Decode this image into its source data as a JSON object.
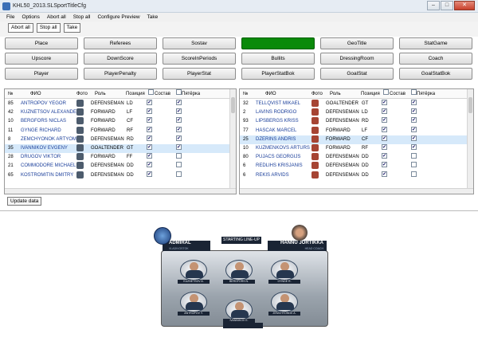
{
  "window": {
    "title": "KHL50_2013.SLSportTitleCfg",
    "buttons": [
      "–",
      "□",
      "✕"
    ]
  },
  "menu": [
    "File",
    "Options",
    "Abort all",
    "Stop all",
    "Configure Preview",
    "Take"
  ],
  "toolbar": [
    "Abort all",
    "Stop all",
    "Take"
  ],
  "grid_buttons": [
    "Place",
    "Referees",
    "Sostav",
    "Starting",
    "GeoTitle",
    "StatGame",
    "Upscore",
    "DownScore",
    "ScoreInPeriods",
    "Bullits",
    "DressingRoom",
    "Coach",
    "Player",
    "PlayerPenalty",
    "PlayerStat",
    "PlayerStatBok",
    "GoalStat",
    "GoalStatBok"
  ],
  "active_button": "Starting",
  "active_color": "#0a8a0a",
  "columns": [
    "№",
    "ФИО",
    "Фото",
    "Роль",
    "Позиция",
    "Состав",
    "Пятёрка"
  ],
  "left_rows": [
    {
      "num": "85",
      "name": "ANTROPOV YEGOR",
      "role": "DEFENSEMAN",
      "pos": "LD",
      "sostav": "✔",
      "pyat": "✔"
    },
    {
      "num": "42",
      "name": "KUZNETSOV ALEXANDER",
      "role": "FORWARD",
      "pos": "LF",
      "sostav": "✔",
      "pyat": "✔"
    },
    {
      "num": "10",
      "name": "BERGFORS NICLAS",
      "role": "FORWARD",
      "pos": "CF",
      "sostav": "✔",
      "pyat": "✔"
    },
    {
      "num": "11",
      "name": "GYNGE RICHARD",
      "role": "FORWARD",
      "pos": "RF",
      "sostav": "✔",
      "pyat": "✔"
    },
    {
      "num": "8",
      "name": "ZEMCHYONOK ARTYOM",
      "role": "DEFENSEMAN",
      "pos": "RD",
      "sostav": "✔",
      "pyat": "✔"
    },
    {
      "num": "35",
      "name": "IVANNIKOV EVGENY",
      "role": "GOALTENDER",
      "pos": "GT",
      "sostav": "✔",
      "pyat": "✔"
    },
    {
      "num": "28",
      "name": "DRUGOV VIKTOR",
      "role": "FORWARD",
      "pos": "FF",
      "sostav": "✔",
      "pyat": ""
    },
    {
      "num": "21",
      "name": "COMMODORE MICHAEL",
      "role": "DEFENSEMAN",
      "pos": "DD",
      "sostav": "✔",
      "pyat": ""
    },
    {
      "num": "65",
      "name": "KOSTROMITIN DMITRY",
      "role": "DEFENSEMAN",
      "pos": "DD",
      "sostav": "✔",
      "pyat": ""
    }
  ],
  "left_selected": 5,
  "right_rows": [
    {
      "num": "32",
      "name": "TELLQVIST MIKAEL",
      "role": "GOALTENDER",
      "pos": "GT",
      "sostav": "✔",
      "pyat": "✔"
    },
    {
      "num": "2",
      "name": "LAVINS RODRIGO",
      "role": "DEFENSEMAN",
      "pos": "LD",
      "sostav": "✔",
      "pyat": "✔"
    },
    {
      "num": "93",
      "name": "LIPSBERGS KRISS",
      "role": "DEFENSEMAN",
      "pos": "RD",
      "sostav": "✔",
      "pyat": "✔"
    },
    {
      "num": "77",
      "name": "HASCAK MARCEL",
      "role": "FORWARD",
      "pos": "LF",
      "sostav": "✔",
      "pyat": "✔"
    },
    {
      "num": "25",
      "name": "DZERINS ANDRIS",
      "role": "FORWARD",
      "pos": "CF",
      "sostav": "✔",
      "pyat": "✔"
    },
    {
      "num": "10",
      "name": "KUZMENKOVS ARTURS",
      "role": "FORWARD",
      "pos": "RF",
      "sostav": "✔",
      "pyat": "✔"
    },
    {
      "num": "80",
      "name": "PUJACS GEORGIJS",
      "role": "DEFENSEMAN",
      "pos": "DD",
      "sostav": "✔",
      "pyat": ""
    },
    {
      "num": "6",
      "name": "REDLIHS KRISJANIS",
      "role": "DEFENSEMAN",
      "pos": "DD",
      "sostav": "✔",
      "pyat": ""
    },
    {
      "num": "6",
      "name": "REKIS ARVIDS",
      "role": "DEFENSEMAN",
      "pos": "DD",
      "sostav": "✔",
      "pyat": ""
    }
  ],
  "right_selected": 4,
  "update_label": "Update data",
  "preview": {
    "team": "ADMIRAL",
    "team_sub": "VLADIVOSTOK",
    "center": "STARTING LINE-UP",
    "coach": "HANNU JORTIKKA",
    "coach_sub": "HEAD COACH",
    "players": [
      "KUZNETSOV A.",
      "BERGFORS N.",
      "GYNGE R.",
      "ANTROPOV Y.",
      "IVANNIKOV E.",
      "ZEMCHYONOK A."
    ]
  }
}
